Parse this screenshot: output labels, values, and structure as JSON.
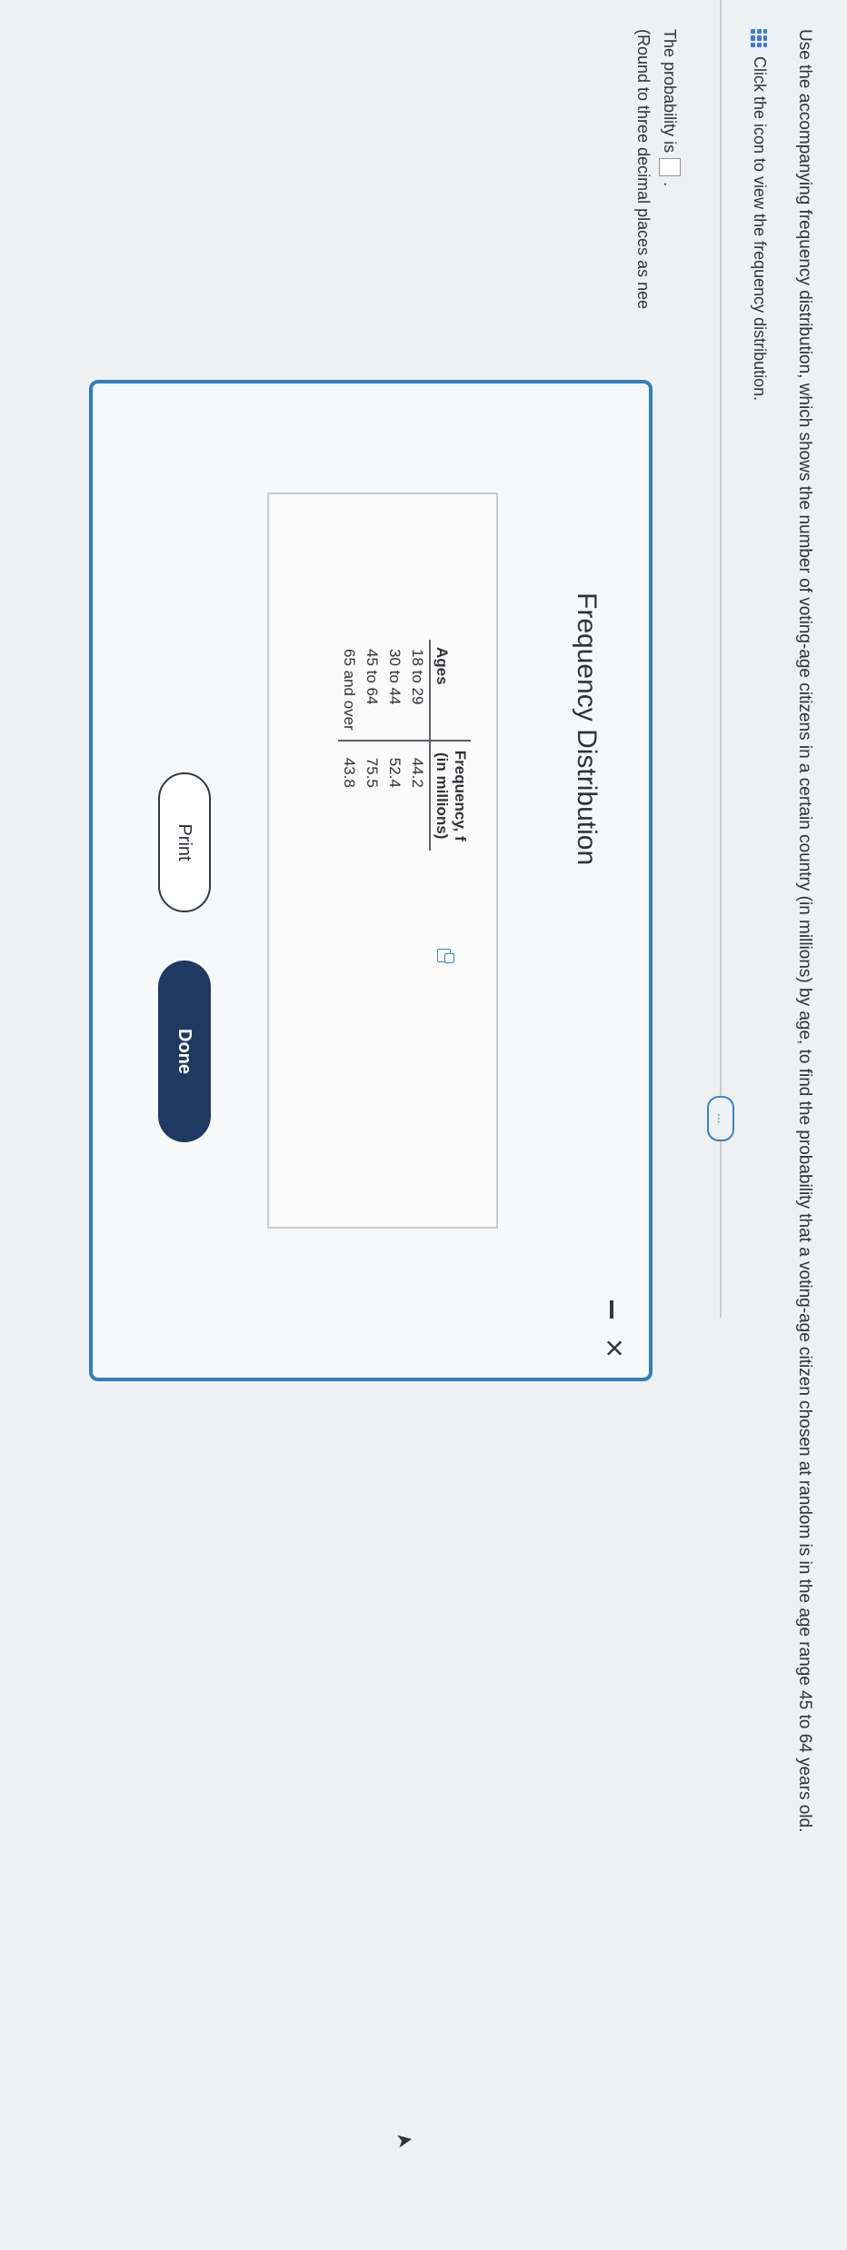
{
  "question": {
    "text": "Use the accompanying frequency distribution, which shows the number of voting-age citizens in a certain country (in millions) by age, to find the probability that a voting-age citizen chosen at random is in the age range 45 to 64 years old.",
    "view_link": "Click the icon to view the frequency distribution.",
    "more_label": "...",
    "answer_prefix": "The probability is",
    "answer_suffix": ".",
    "round_note": "(Round to three decimal places as nee"
  },
  "modal": {
    "title": "Frequency Distribution",
    "minimize_label": "minimize",
    "close_label": "×",
    "table": {
      "headers": {
        "ages": "Ages",
        "freq_line1": "Frequency, f",
        "freq_line2": "(in millions)"
      },
      "rows": [
        {
          "ages": "18 to 29",
          "freq": "44.2"
        },
        {
          "ages": "30 to 44",
          "freq": "52.4"
        },
        {
          "ages": "45 to 64",
          "freq": "75.5"
        },
        {
          "ages": "65 and over",
          "freq": "43.8"
        }
      ]
    },
    "print_label": "Print",
    "done_label": "Done"
  },
  "colors": {
    "accent": "#2f7fbf",
    "done_button": "#1f3a62",
    "page_background": "#eef0f2"
  },
  "icons": [
    "grid-icon",
    "copy-icon",
    "close-icon",
    "minimize-icon",
    "mouse-cursor-icon"
  ]
}
